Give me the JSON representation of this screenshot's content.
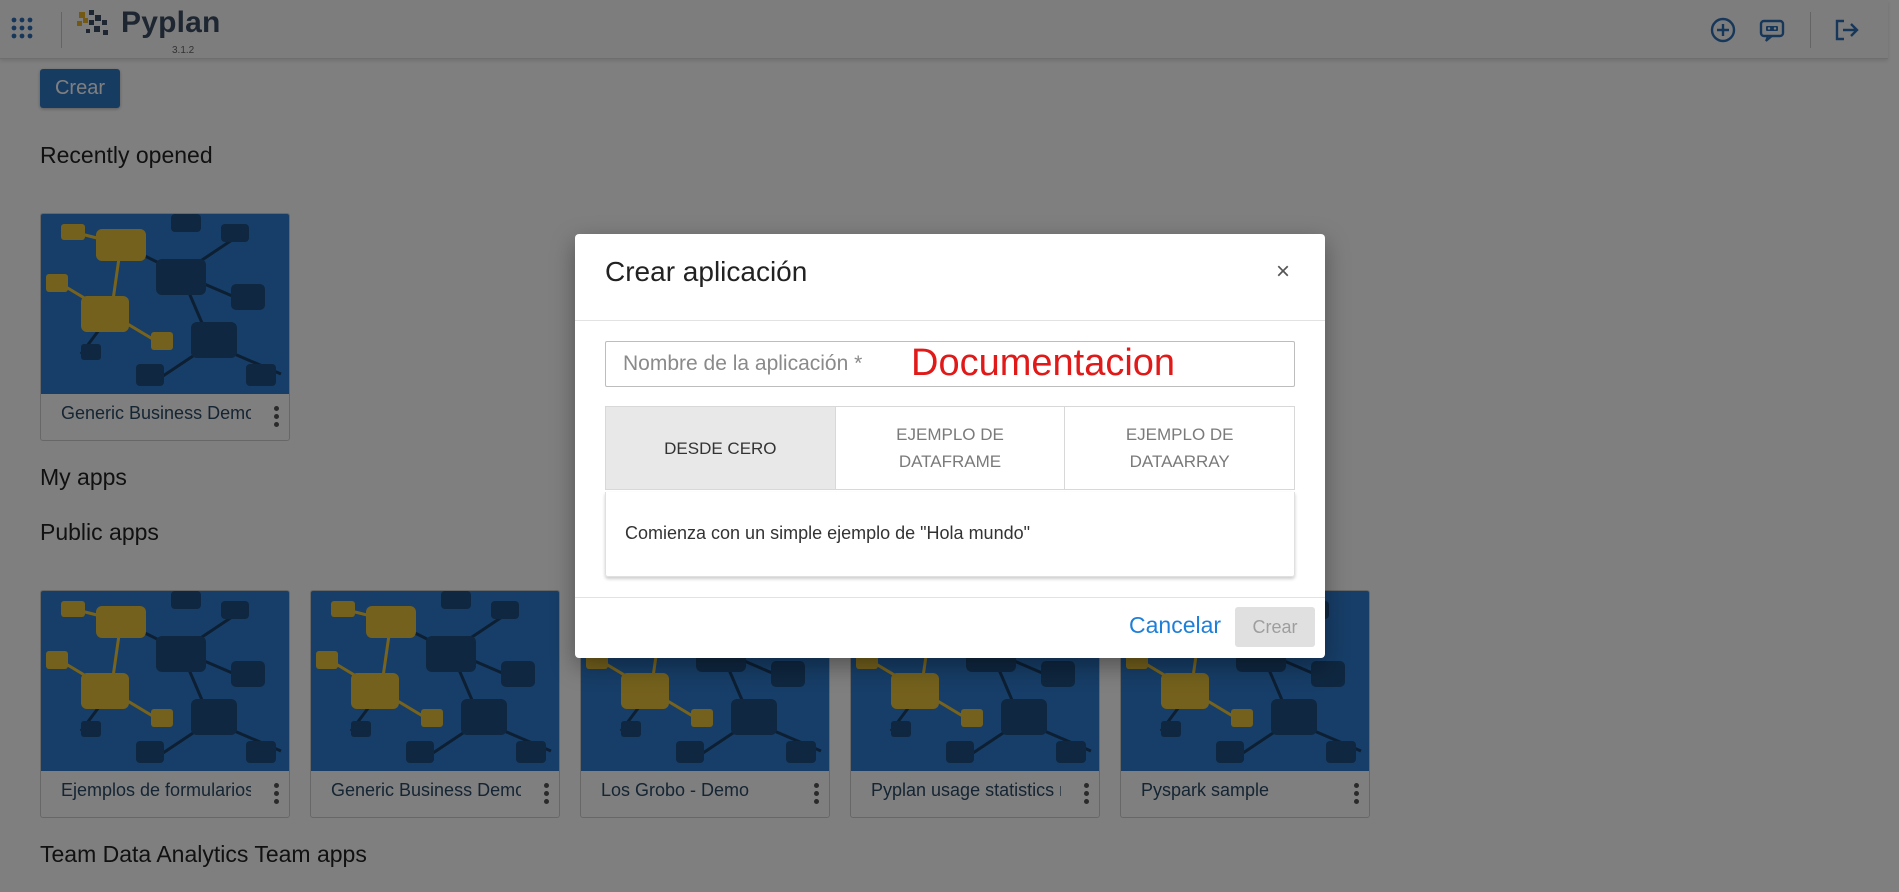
{
  "app": {
    "brand": "Pyplan",
    "version": "3.1.2"
  },
  "topbar": {
    "icons": [
      "apps-grid-icon",
      "pyplan-logo",
      "add-circle-icon",
      "chat-bot-icon",
      "logout-icon"
    ]
  },
  "main": {
    "create_button": "Crear",
    "sections": {
      "recent": "Recently opened",
      "my_apps": "My apps",
      "public_apps": "Public apps",
      "team_apps": "Team Data Analytics Team apps"
    },
    "recent_apps": [
      {
        "name": "Generic Business Demo"
      }
    ],
    "public_apps": [
      {
        "name": "Ejemplos de formularios"
      },
      {
        "name": "Generic Business Demo"
      },
      {
        "name": "Los Grobo - Demo"
      },
      {
        "name": "Pyplan usage statistics model"
      },
      {
        "name": "Pyspark sample"
      }
    ]
  },
  "modal": {
    "title": "Crear aplicación",
    "close": "×",
    "name_field": {
      "placeholder": "Nombre de la aplicación *",
      "value": "Documentacion"
    },
    "tabs": [
      {
        "label": "DESDE CERO",
        "active": true
      },
      {
        "label": "EJEMPLO DE DATAFRAME",
        "active": false
      },
      {
        "label": "EJEMPLO DE DATAARRAY",
        "active": false
      }
    ],
    "tab_description": "Comienza con un simple ejemplo de \"Hola mundo\"",
    "cancel_label": "Cancelar",
    "create_label": "Crear"
  },
  "colors": {
    "primary": "#2f78c4",
    "link": "#1e7fd8",
    "thumb_bg": "#2e7dd0",
    "thumb_accent": "#e8c23a",
    "typed_value": "#e01919"
  }
}
